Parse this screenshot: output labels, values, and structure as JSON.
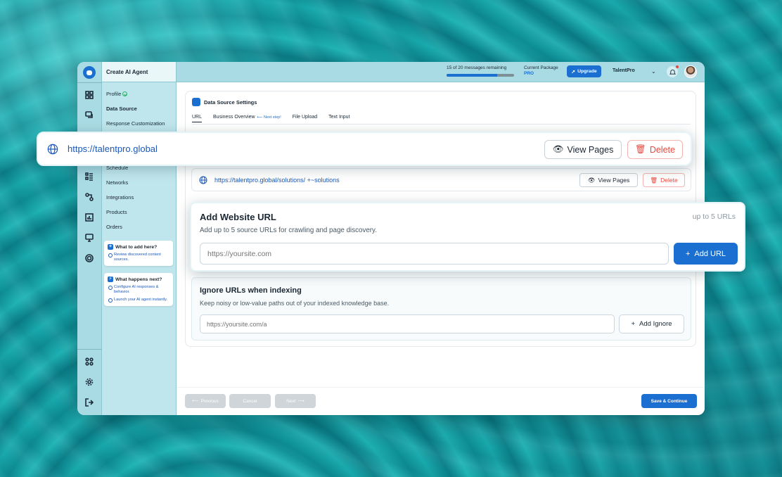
{
  "colors": {
    "accent": "#1b6fd1",
    "danger": "#e8473d",
    "success": "#2db36a",
    "link": "#1b58b8"
  },
  "sidebar": {
    "title": "Create AI Agent",
    "items": [
      {
        "label": "Profile",
        "done": true
      },
      {
        "label": "Data Source",
        "active": true
      },
      {
        "label": "Response Customization"
      },
      {
        "label": "Schedule"
      },
      {
        "label": "Networks"
      },
      {
        "label": "Integrations"
      },
      {
        "label": "Products"
      },
      {
        "label": "Orders"
      }
    ],
    "help": [
      {
        "title": "What to add here?",
        "icon": "plus-icon",
        "bullets": [
          "Review discovered content sources."
        ]
      },
      {
        "title": "What happens next?",
        "icon": "lightning-icon",
        "bullets": [
          "Configure AI responses & behavior.",
          "Launch your AI agent instantly."
        ]
      }
    ]
  },
  "rail_icons": [
    "chat-logo-icon",
    "dashboard-icon",
    "chat-icon",
    "list-icon",
    "flow-icon",
    "chart-icon",
    "monitor-icon",
    "target-icon",
    "apps-icon",
    "settings-icon",
    "logout-icon"
  ],
  "header": {
    "messages": "15 of 20 messages remaining",
    "messages_progress": 0.75,
    "package_label": "Current Package",
    "package_name": "PRO",
    "upgrade_label": "Upgrade",
    "account": "TalentPro",
    "has_notification": true
  },
  "main": {
    "title": "Data Source Settings",
    "tabs": [
      {
        "label": "URL",
        "active": true
      },
      {
        "label": "Business Overview",
        "hint": "Next step!"
      },
      {
        "label": "File Upload"
      },
      {
        "label": "Text Input"
      }
    ],
    "urls": [
      {
        "url": "https://talentpro.global",
        "view": "View Pages",
        "delete": "Delete"
      },
      {
        "url": "https://talentpro.global/solutions/ +~solutions",
        "view": "View Pages",
        "delete": "Delete"
      }
    ],
    "add_url": {
      "title": "Add Website URL",
      "limit": "up to 5 URLs",
      "subtitle": "Add up to 5 source URLs for crawling and page discovery.",
      "placeholder": "https://yoursite.com",
      "button": "Add URL"
    },
    "ignore": {
      "title": "Ignore URLs when indexing",
      "subtitle": "Keep noisy or low-value paths out of your indexed knowledge base.",
      "placeholder": "https://yoursite.com/a",
      "button": "Add Ignore"
    }
  },
  "footer": {
    "previous": "Previous",
    "cancel": "Cancel",
    "next": "Next",
    "save": "Save & Continue"
  }
}
